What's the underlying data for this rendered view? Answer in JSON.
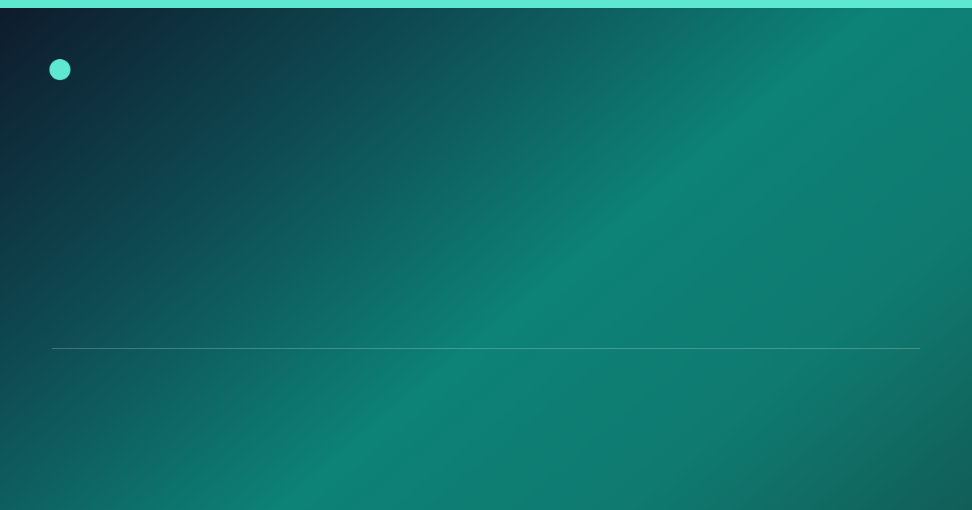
{
  "brand": {
    "name": "",
    "accent_color": "#5ee8d2"
  },
  "headline": "",
  "subline": "",
  "stats": [
    {
      "label": "",
      "value": ""
    },
    {
      "label": "",
      "value": ""
    },
    {
      "label": "",
      "value": ""
    }
  ],
  "colors": {
    "accent": "#5ee8d2",
    "background_dark": "#0e1a2c",
    "background_teal": "#0d8277"
  }
}
